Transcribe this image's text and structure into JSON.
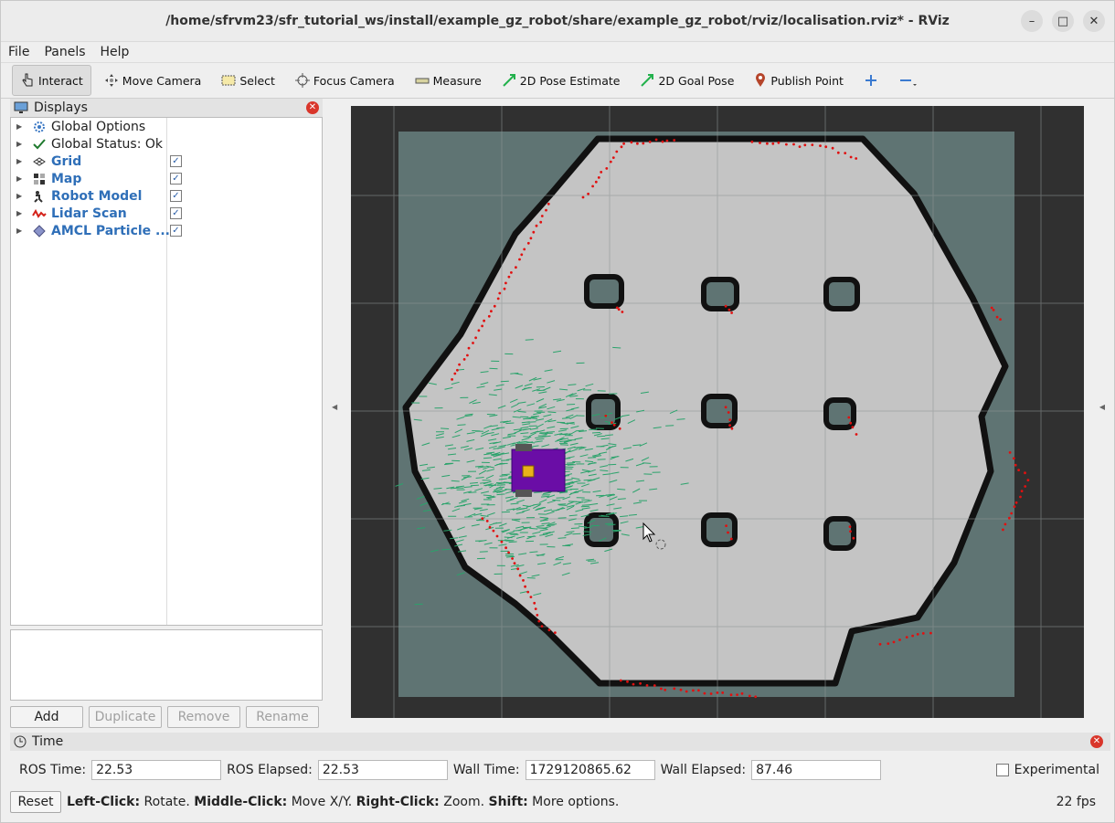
{
  "window": {
    "title": "/home/sfrvm23/sfr_tutorial_ws/install/example_gz_robot/share/example_gz_robot/rviz/localisation.rviz* - RViz",
    "minimize": "–",
    "maximize": "□",
    "close": "✕"
  },
  "menu": [
    "File",
    "Panels",
    "Help"
  ],
  "toolbar": {
    "interact": "Interact",
    "move_camera": "Move Camera",
    "select": "Select",
    "focus_camera": "Focus Camera",
    "measure": "Measure",
    "pose_estimate": "2D Pose Estimate",
    "goal_pose": "2D Goal Pose",
    "publish_point": "Publish Point"
  },
  "displays": {
    "title": "Displays",
    "items": [
      {
        "label": "Global Options",
        "icon": "gear-icon",
        "checkbox": false,
        "blue": false
      },
      {
        "label": "Global Status: Ok",
        "icon": "checkmark-icon",
        "checkbox": false,
        "blue": false
      },
      {
        "label": "Grid",
        "icon": "grid-icon",
        "checkbox": true,
        "blue": true
      },
      {
        "label": "Map",
        "icon": "map-icon",
        "checkbox": true,
        "blue": true
      },
      {
        "label": "Robot Model",
        "icon": "robot-icon",
        "checkbox": true,
        "blue": true
      },
      {
        "label": "Lidar Scan",
        "icon": "laser-icon",
        "checkbox": true,
        "blue": true
      },
      {
        "label": "AMCL Particle ...",
        "icon": "particle-icon",
        "checkbox": true,
        "blue": true
      }
    ],
    "buttons": {
      "add": "Add",
      "duplicate": "Duplicate",
      "remove": "Remove",
      "rename": "Rename"
    }
  },
  "time": {
    "title": "Time",
    "ros_time_label": "ROS Time:",
    "ros_time": "22.53",
    "ros_elapsed_label": "ROS Elapsed:",
    "ros_elapsed": "22.53",
    "wall_time_label": "Wall Time:",
    "wall_time": "1729120865.62",
    "wall_elapsed_label": "Wall Elapsed:",
    "wall_elapsed": "87.46",
    "experimental": "Experimental"
  },
  "status": {
    "reset": "Reset",
    "h1": "Left-Click:",
    "t1": " Rotate. ",
    "h2": "Middle-Click:",
    "t2": " Move X/Y. ",
    "h3": "Right-Click:",
    "t3": " Zoom. ",
    "h4": "Shift:",
    "t4": " More options.",
    "fps": "22 fps"
  },
  "colors": {
    "map_free": "#c4c4c4",
    "map_unknown": "#5f7473",
    "wall": "#111111",
    "particle": "#2aa36b",
    "lidar": "#e11010",
    "robot": "#6a0da6"
  }
}
